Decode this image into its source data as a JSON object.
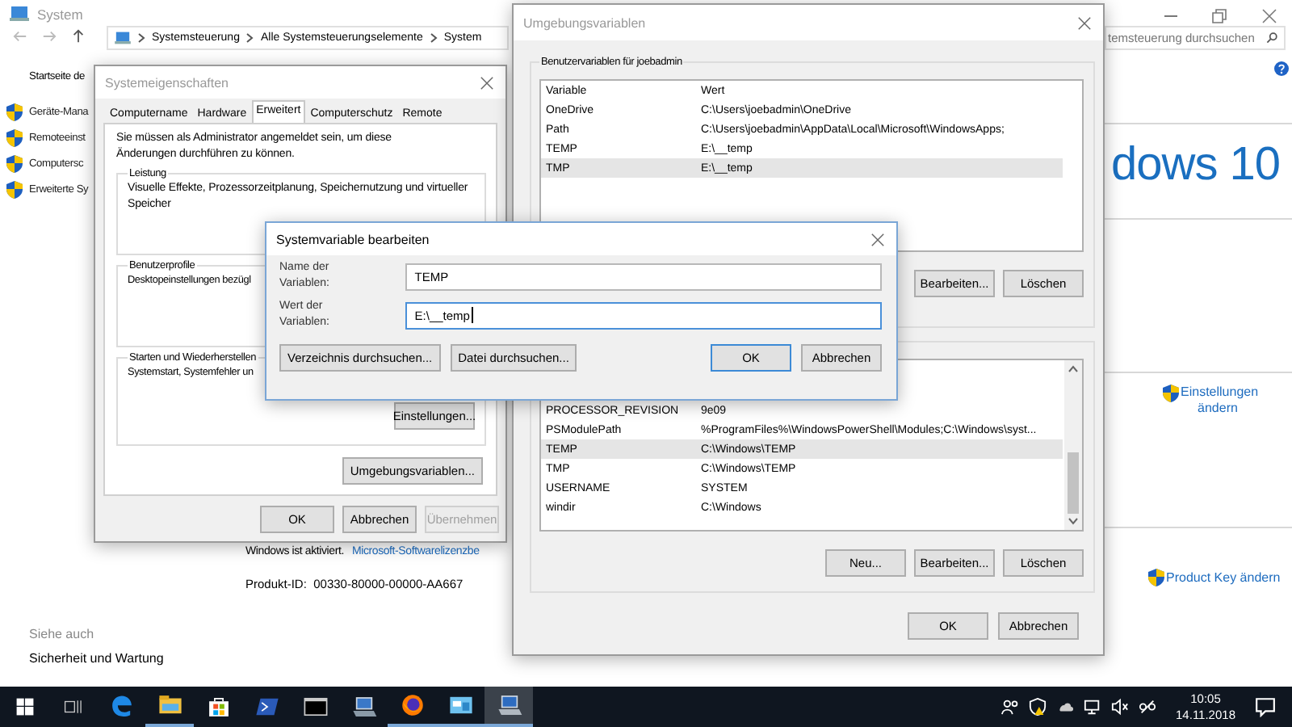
{
  "system_window": {
    "title": "System",
    "breadcrumb": [
      "Systemsteuerung",
      "Alle Systemsteuerungselemente",
      "System"
    ],
    "search": {
      "placeholder": "temsteuerung durchsuchen"
    },
    "sidebar": {
      "home": "Startseite de",
      "items": [
        "Geräte-Mana",
        "Remoteeinst",
        "Computersc",
        "Erweiterte Sy"
      ]
    },
    "logo": "dows 10",
    "activation": {
      "status": "Windows ist aktiviert.",
      "link": "Microsoft-Softwarelizenzbe"
    },
    "product_id": "Produkt-ID:  00330-80000-00000-AA667",
    "links": [
      "Einstellungen ändern",
      "Product Key ändern"
    ],
    "see_also": {
      "title": "Siehe auch",
      "items": [
        "Sicherheit und Wartung"
      ]
    }
  },
  "system_properties": {
    "title": "Systemeigenschaften",
    "tabs": [
      {
        "label": "Computername",
        "selected": false
      },
      {
        "label": "Hardware",
        "selected": false
      },
      {
        "label": "Erweitert",
        "selected": true
      },
      {
        "label": "Computerschutz",
        "selected": false
      },
      {
        "label": "Remote",
        "selected": false
      }
    ],
    "notice": "Sie müssen als Administrator angemeldet sein, um diese Änderungen durchführen zu können.",
    "groups": [
      {
        "title": "Leistung",
        "text": "Visuelle Effekte, Prozessorzeitplanung, Speichernutzung und virtueller Speicher"
      },
      {
        "title": "Benutzerprofile",
        "text": "Desktopeinstellungen bezügl"
      },
      {
        "title": "Starten und Wiederherstellen",
        "text": "Systemstart, Systemfehler un",
        "button": "Einstellungen..."
      }
    ],
    "env_button": "Umgebungsvariablen...",
    "buttons": [
      {
        "label": "OK",
        "disabled": false
      },
      {
        "label": "Abbrechen",
        "disabled": false
      },
      {
        "label": "Übernehmen",
        "disabled": true
      }
    ]
  },
  "env_vars": {
    "title": "Umgebungsvariablen",
    "user_group": {
      "title": "Benutzervariablen für joebadmin",
      "columns": [
        "Variable",
        "Wert"
      ],
      "rows": [
        {
          "variable": "OneDrive",
          "value": "C:\\Users\\joebadmin\\OneDrive",
          "selected": false
        },
        {
          "variable": "Path",
          "value": "C:\\Users\\joebadmin\\AppData\\Local\\Microsoft\\WindowsApps;",
          "selected": false
        },
        {
          "variable": "TEMP",
          "value": "E:\\__temp",
          "selected": false
        },
        {
          "variable": "TMP",
          "value": "E:\\__temp",
          "selected": true
        }
      ],
      "buttons": [
        "Bearbeiten...",
        "Löschen"
      ]
    },
    "system_group": {
      "rows": [
        {
          "variable": "PROCESSOR_REVISION",
          "value": "9e09",
          "selected": false
        },
        {
          "variable": "PSModulePath",
          "value": "%ProgramFiles%\\WindowsPowerShell\\Modules;C:\\Windows\\syst...",
          "selected": false
        },
        {
          "variable": "TEMP",
          "value": "C:\\Windows\\TEMP",
          "selected": true
        },
        {
          "variable": "TMP",
          "value": "C:\\Windows\\TEMP",
          "selected": false
        },
        {
          "variable": "USERNAME",
          "value": "SYSTEM",
          "selected": false
        },
        {
          "variable": "windir",
          "value": "C:\\Windows",
          "selected": false
        }
      ],
      "buttons": [
        "Neu...",
        "Bearbeiten...",
        "Löschen"
      ]
    },
    "buttons": [
      "OK",
      "Abbrechen"
    ]
  },
  "edit_dialog": {
    "title": "Systemvariable bearbeiten",
    "fields": [
      {
        "label": "Name der Variablen:",
        "value": "TEMP",
        "focused": false
      },
      {
        "label": "Wert der Variablen:",
        "value": "E:\\__temp",
        "focused": true
      }
    ],
    "buttons": [
      {
        "label": "Verzeichnis durchsuchen...",
        "default": false
      },
      {
        "label": "Datei durchsuchen...",
        "default": false
      },
      {
        "label": "OK",
        "default": true
      },
      {
        "label": "Abbrechen",
        "default": false
      }
    ]
  },
  "taskbar": {
    "apps": [
      {
        "running": false,
        "selected": false
      },
      {
        "running": true,
        "selected": false
      },
      {
        "running": false,
        "selected": false
      },
      {
        "running": false,
        "selected": false
      },
      {
        "running": false,
        "selected": false
      },
      {
        "running": false,
        "selected": false
      },
      {
        "running": true,
        "selected": false
      },
      {
        "running": true,
        "selected": false
      },
      {
        "running": true,
        "selected": true
      }
    ],
    "clock": {
      "time": "10:05",
      "date": "14.11.2018"
    }
  }
}
